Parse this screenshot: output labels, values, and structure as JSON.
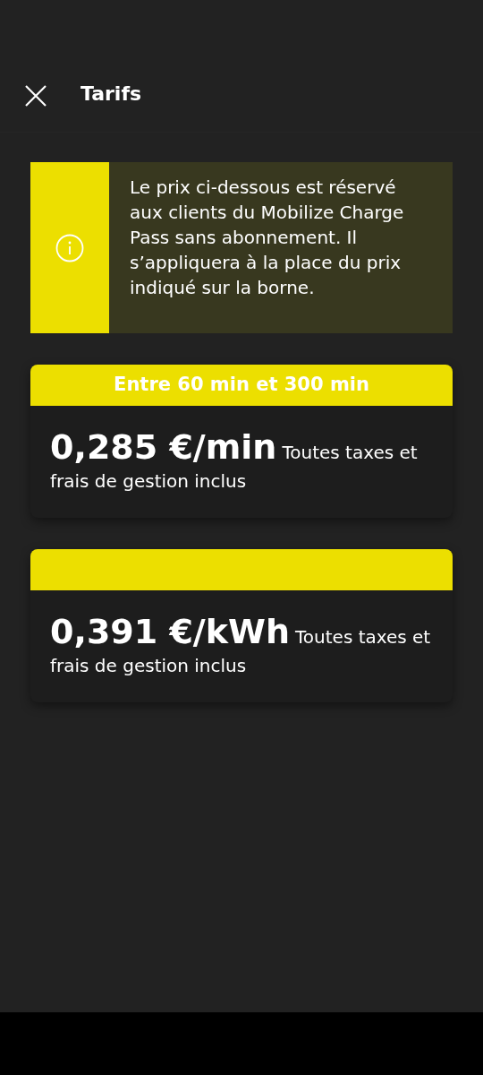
{
  "header": {
    "title": "Tarifs"
  },
  "notice": {
    "text": "Le prix ci-dessous est réservé aux clients du Mobilize Charge Pass sans abonnement. Il s’appliquera à la place du prix indiqué sur la borne."
  },
  "tariffs": [
    {
      "period": "Entre 60 min et 300 min",
      "price": "0,285 €/min",
      "note": "Toutes taxes et frais de gestion inclus"
    },
    {
      "price": "0,391 €/kWh",
      "note": "Toutes taxes et frais de gestion inclus"
    }
  ]
}
